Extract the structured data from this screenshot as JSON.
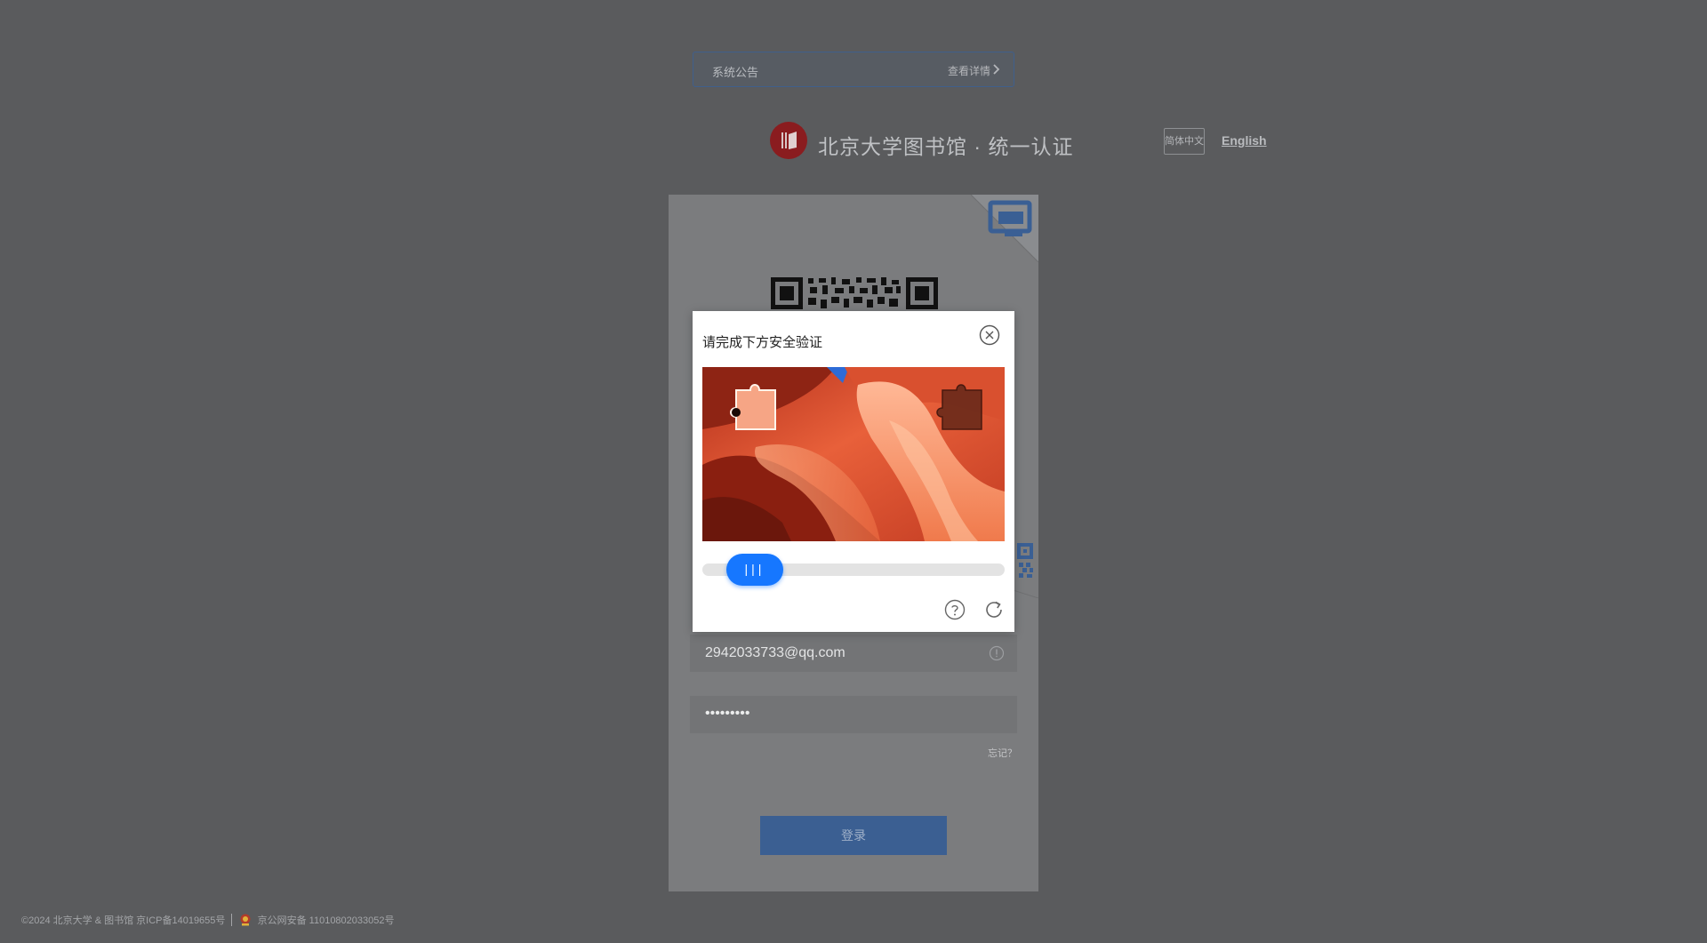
{
  "notice": {
    "text": "系统公告",
    "link": "查看详情"
  },
  "brand": {
    "name": "北京大学图书馆 · 统一认证"
  },
  "lang": {
    "current": "简体中文",
    "english": "English"
  },
  "login": {
    "email_value": "2942033733@qq.com",
    "password_masked": "•••••••••",
    "forgot_label": "忘记？",
    "submit_label": "登录"
  },
  "captcha": {
    "title": "请完成下方安全验证",
    "slider_grip": "|||"
  },
  "footer": {
    "copyright": "©2024 北京大学 & 图书馆 京ICP备14019655号",
    "police": "京公网安备 11010802033052号"
  },
  "colors": {
    "overlay_bg": "#5a5b5d",
    "slider_accent": "#1677ff",
    "login_button": "#3b5f92",
    "logo_red": "#8a1c1f"
  }
}
